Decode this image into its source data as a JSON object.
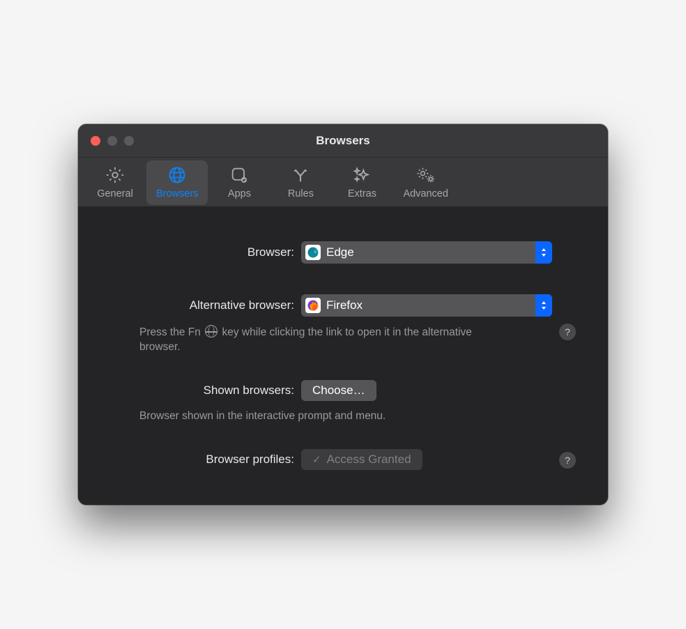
{
  "window": {
    "title": "Browsers"
  },
  "tabs": [
    {
      "label": "General"
    },
    {
      "label": "Browsers"
    },
    {
      "label": "Apps"
    },
    {
      "label": "Rules"
    },
    {
      "label": "Extras"
    },
    {
      "label": "Advanced"
    }
  ],
  "form": {
    "browser_label": "Browser:",
    "browser_value": "Edge",
    "alt_label": "Alternative browser:",
    "alt_value": "Firefox",
    "alt_hint_prefix": "Press the Fn ",
    "alt_hint_suffix": " key while clicking the link to open it in the alternative browser.",
    "shown_label": "Shown browsers:",
    "choose_button": "Choose…",
    "shown_hint": "Browser shown in the interactive prompt and menu.",
    "profiles_label": "Browser profiles:",
    "profiles_value": "Access Granted",
    "help_symbol": "?"
  }
}
